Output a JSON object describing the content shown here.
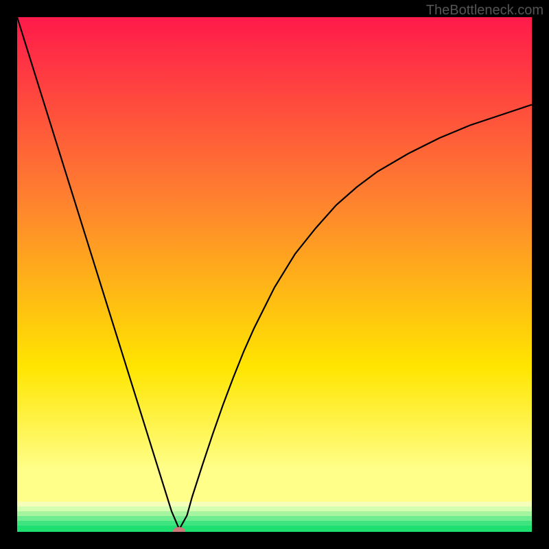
{
  "watermark": "TheBottleneck.com",
  "chart_data": {
    "type": "line",
    "title": "",
    "xlabel": "",
    "ylabel": "",
    "x": [
      0,
      2,
      4,
      6,
      8,
      10,
      12,
      14,
      16,
      18,
      20,
      22,
      24,
      26,
      28,
      30,
      31.5,
      33,
      34,
      36,
      38,
      40,
      42,
      44,
      46,
      50,
      54,
      58,
      62,
      66,
      70,
      76,
      82,
      88,
      94,
      100
    ],
    "values": [
      100,
      93.6,
      87.2,
      80.8,
      74.4,
      68,
      61.6,
      55.2,
      48.8,
      42.4,
      36,
      29.6,
      23.2,
      16.8,
      10.4,
      4,
      0.5,
      3.2,
      6.8,
      13,
      19,
      24.7,
      30,
      35,
      39.5,
      47.5,
      54,
      59,
      63.5,
      67,
      70,
      73.5,
      76.5,
      79,
      81,
      83
    ],
    "xlim": [
      0,
      100
    ],
    "ylim": [
      0,
      100
    ],
    "marker_position": {
      "x": 31.5,
      "y": 0.2
    },
    "gradient": {
      "top_color": "#ff1a4a",
      "mid_orange": "#ff8030",
      "mid_yellow": "#ffe500",
      "light_yellow": "#ffff8a",
      "green": "#1ee070",
      "band_colors": [
        "#f5ffba",
        "#d5ffb0",
        "#a5f5a0",
        "#70ec90",
        "#3ee480",
        "#1ee070"
      ]
    },
    "marker_color": "#cc7a7a"
  }
}
